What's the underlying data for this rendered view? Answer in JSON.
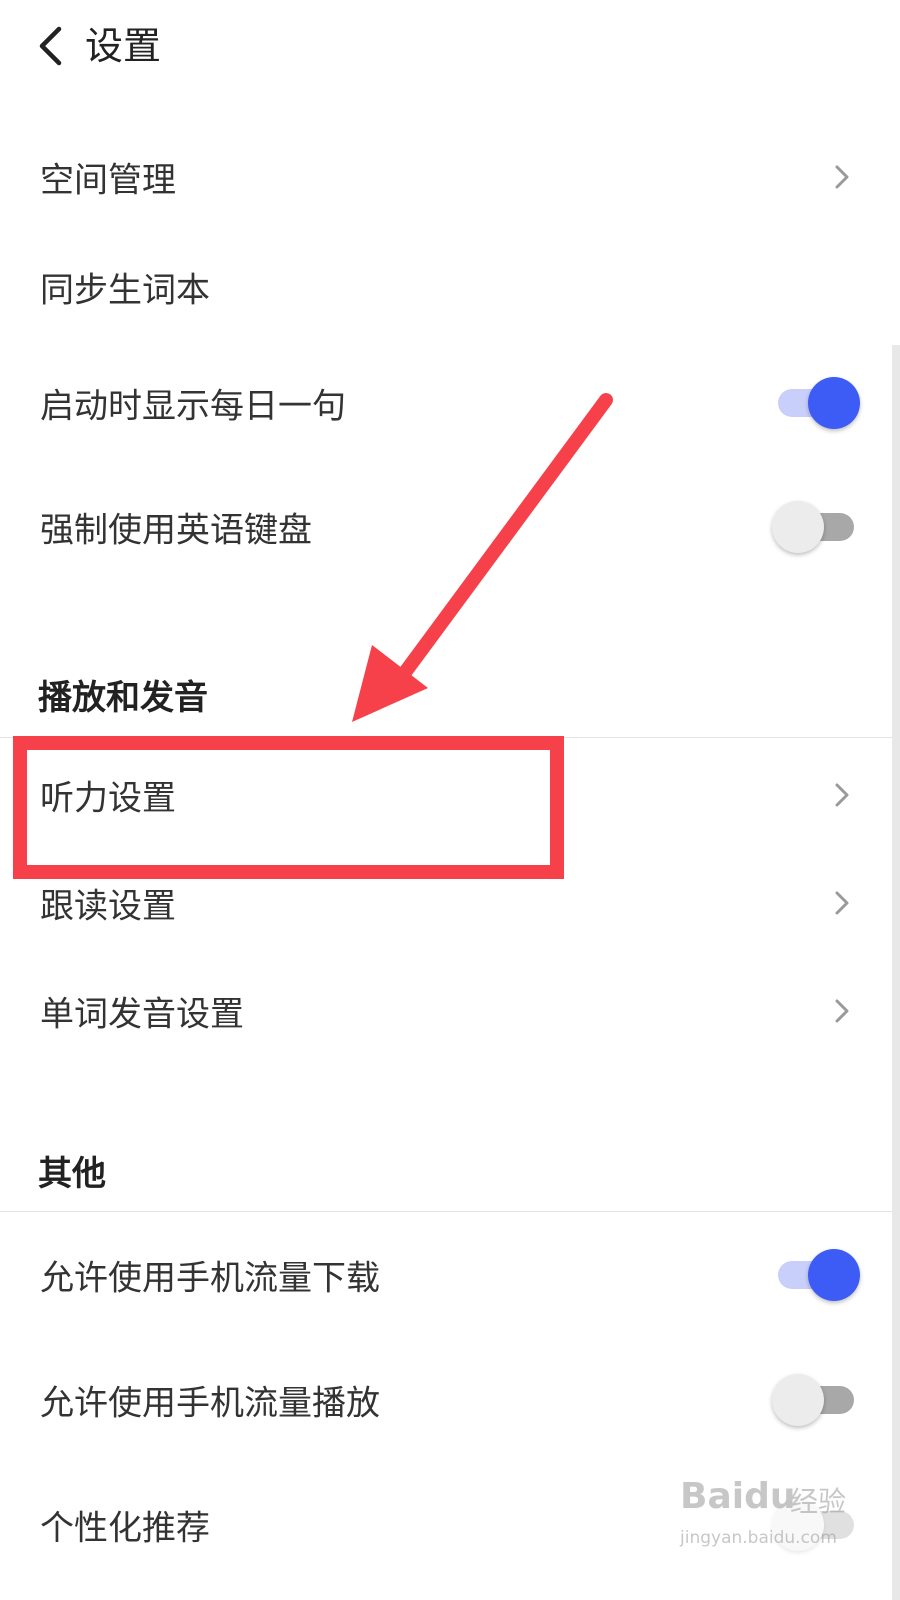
{
  "header": {
    "title": "设置",
    "back_icon": "chevron-left-icon"
  },
  "general": {
    "items": [
      {
        "label": "空间管理",
        "type": "nav"
      },
      {
        "label": "同步生词本",
        "type": "nav"
      },
      {
        "label": "启动时显示每日一句",
        "type": "toggle",
        "on": true
      },
      {
        "label": "强制使用英语键盘",
        "type": "toggle",
        "on": false
      }
    ]
  },
  "playback": {
    "title": "播放和发音",
    "items": [
      {
        "label": "听力设置",
        "type": "nav"
      },
      {
        "label": "跟读设置",
        "type": "nav"
      },
      {
        "label": "单词发音设置",
        "type": "nav"
      }
    ]
  },
  "other": {
    "title": "其他",
    "items": [
      {
        "label": "允许使用手机流量下载",
        "type": "toggle",
        "on": true
      },
      {
        "label": "允许使用手机流量播放",
        "type": "toggle",
        "on": false
      },
      {
        "label": "个性化推荐",
        "type": "toggle"
      }
    ]
  },
  "colors": {
    "toggle_on": "#3d5cf5",
    "toggle_on_track": "#c9cffb",
    "toggle_off_track": "#a8a8a8",
    "annotation_red": "#f6414b"
  },
  "watermark": {
    "logo": "Baidu",
    "cn": "经验",
    "url": "jingyan.baidu.com"
  }
}
